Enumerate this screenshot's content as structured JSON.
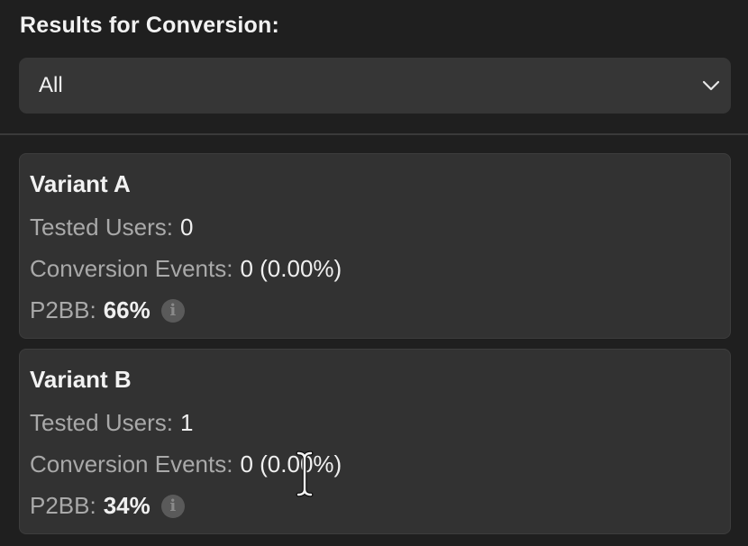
{
  "header": {
    "title": "Results for Conversion:"
  },
  "filter": {
    "selected": "All"
  },
  "variants": [
    {
      "name": "Variant A",
      "tested_users_label": "Tested Users:",
      "tested_users_value": "0",
      "conversion_label": "Conversion Events:",
      "conversion_value": "0 (0.00%)",
      "p2bb_label": "P2BB:",
      "p2bb_value": "66%"
    },
    {
      "name": "Variant B",
      "tested_users_label": "Tested Users:",
      "tested_users_value": "1",
      "conversion_label": "Conversion Events:",
      "conversion_value": "0 (0.00%)",
      "p2bb_label": "P2BB:",
      "p2bb_value": "34%"
    }
  ],
  "icons": {
    "chevron": "chevron-down-icon",
    "info": "info-icon",
    "cursor": "text-cursor-icon"
  },
  "colors": {
    "background": "#1f1f1f",
    "card": "#323232",
    "select": "#363636",
    "label": "#a9a9a9",
    "value": "#f0f0f0"
  }
}
